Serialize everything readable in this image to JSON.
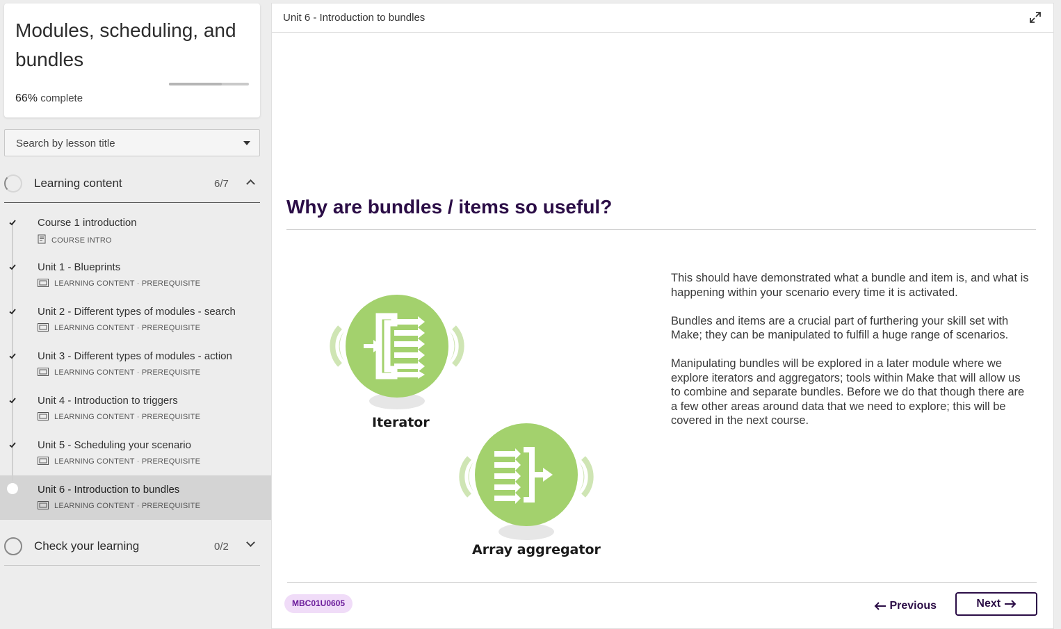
{
  "course": {
    "title": "Modules, scheduling, and bundles",
    "progress_pct": "66%",
    "progress_suffix": "complete",
    "progress_fraction": 0.66
  },
  "search": {
    "placeholder": "Search by lesson title"
  },
  "sections": {
    "learning": {
      "label": "Learning content",
      "count": "6/7"
    },
    "check": {
      "label": "Check your learning",
      "count": "0/2"
    }
  },
  "lessons": [
    {
      "title": "Course 1 introduction",
      "meta": "COURSE INTRO",
      "icon": "document-icon"
    },
    {
      "title": "Unit 1 - Blueprints",
      "meta": "LEARNING CONTENT · PREREQUISITE",
      "icon": "slides-icon"
    },
    {
      "title": "Unit 2 - Different types of modules - search",
      "meta": "LEARNING CONTENT · PREREQUISITE",
      "icon": "slides-icon"
    },
    {
      "title": "Unit 3 - Different types of modules - action",
      "meta": "LEARNING CONTENT · PREREQUISITE",
      "icon": "slides-icon"
    },
    {
      "title": "Unit 4 - Introduction to triggers",
      "meta": "LEARNING CONTENT · PREREQUISITE",
      "icon": "slides-icon"
    },
    {
      "title": "Unit 5 - Scheduling your scenario",
      "meta": "LEARNING CONTENT · PREREQUISITE",
      "icon": "slides-icon"
    },
    {
      "title": "Unit 6 - Introduction to bundles",
      "meta": "LEARNING CONTENT · PREREQUISITE",
      "icon": "slides-icon"
    }
  ],
  "main": {
    "unit_title": "Unit 6 - Introduction to bundles",
    "heading": "Why are bundles / items so useful?",
    "paragraphs": [
      "This should have demonstrated what a bundle and item is, and what is happening within your scenario every time it is activated.",
      "Bundles and items are a crucial part of furthering your skill set with Make; they can be manipulated to fulfill a huge range of scenarios.",
      "Manipulating bundles will be explored in a later module where we explore iterators and aggregators; tools within Make that will allow us to combine and separate bundles. Before we do that though there are a few other areas around data that we need to explore; this will be covered in the next course."
    ],
    "modules": {
      "iterator": "Iterator",
      "aggregator": "Array aggregator"
    },
    "code": "MBC01U0605",
    "prev_label": "Previous",
    "next_label": "Next"
  },
  "colors": {
    "accent": "#2b0d46",
    "module_green": "#a3d16d",
    "badge_bg": "#f0dcf8"
  }
}
